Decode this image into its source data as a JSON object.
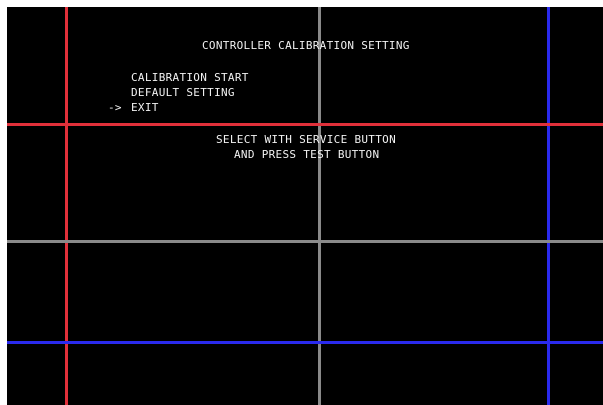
{
  "screen": {
    "title": "CONTROLLER CALIBRATION SETTING",
    "menu": [
      {
        "label": "CALIBRATION START"
      },
      {
        "label": "DEFAULT SETTING"
      },
      {
        "label": "EXIT"
      }
    ],
    "cursor": "->",
    "selected_index": 2,
    "instructions": [
      "SELECT WITH SERVICE BUTTON",
      "AND PRESS TEST BUTTON"
    ]
  },
  "grid_colors": {
    "red": "#e0303a",
    "gray": "#8a8a8a",
    "blue": "#2a2aee"
  }
}
